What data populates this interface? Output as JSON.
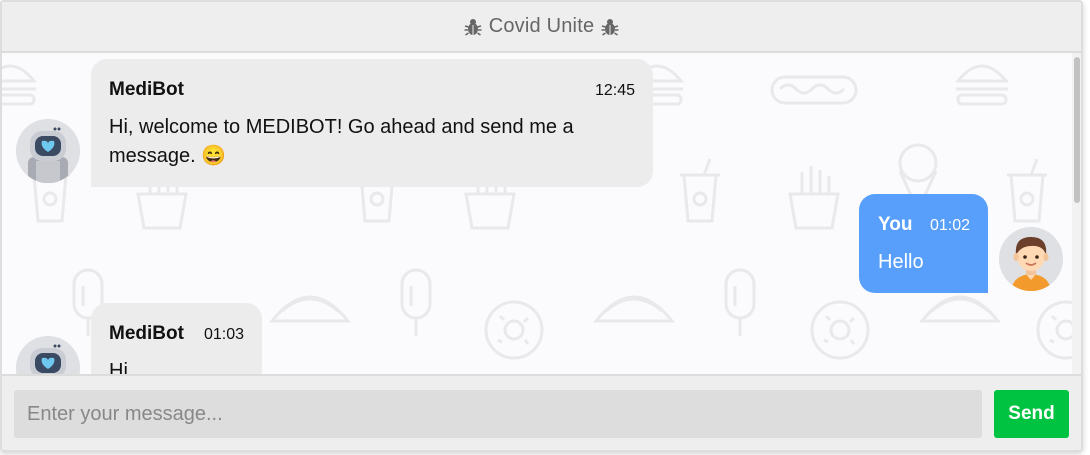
{
  "header": {
    "title": "Covid Unite",
    "left_icon": "bug-icon",
    "right_icon": "bug-icon"
  },
  "messages": [
    {
      "sender": "MediBot",
      "time": "12:45",
      "text": "Hi, welcome to MEDIBOT! Go ahead and send me a message. 😄",
      "side": "left",
      "avatar": "robot-avatar"
    },
    {
      "sender": "You",
      "time": "01:02",
      "text": "Hello",
      "side": "right",
      "avatar": "user-avatar"
    },
    {
      "sender": "MediBot",
      "time": "01:03",
      "text": "Hi",
      "side": "left",
      "avatar": "robot-avatar"
    }
  ],
  "input": {
    "placeholder": "Enter your message...",
    "value": ""
  },
  "send_button": {
    "label": "Send"
  },
  "colors": {
    "header_bg": "#eeeeee",
    "bot_bubble": "#ececec",
    "user_bubble": "#579ffb",
    "send_button": "#00c441",
    "input_bg": "#dddddd"
  }
}
